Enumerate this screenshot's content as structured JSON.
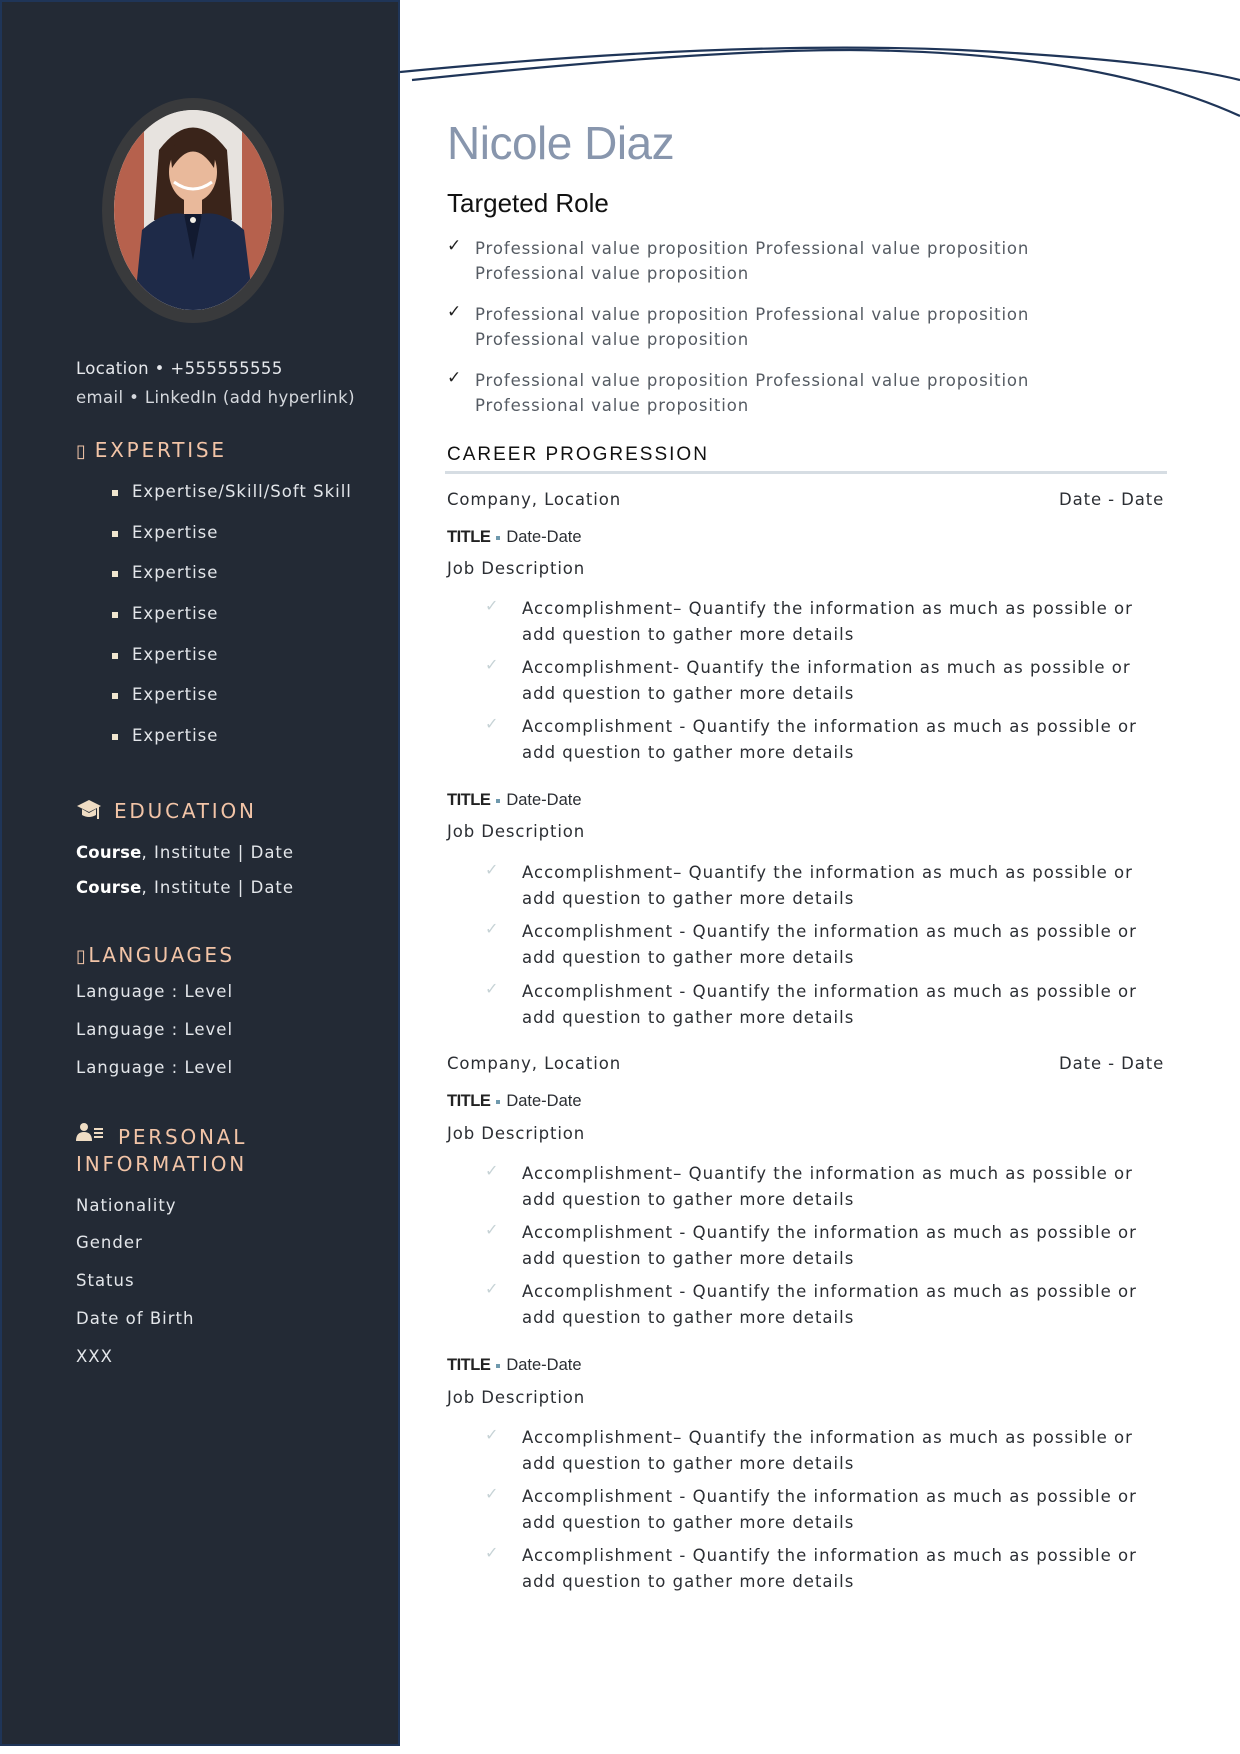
{
  "sidebar": {
    "photo_alt": "Profile photo of a smiling woman in a navy pinstripe blazer",
    "contact": {
      "line1": "Location • +555555555",
      "line2": "email • LinkedIn (add hyperlink)"
    },
    "expertise": {
      "icon": "▯",
      "title": "EXPERTISE",
      "items": [
        "Expertise/Skill/Soft Skill",
        "Expertise",
        "Expertise",
        "Expertise",
        "Expertise",
        "Expertise",
        "Expertise"
      ]
    },
    "education": {
      "title": "EDUCATION",
      "items": [
        {
          "course": "Course",
          "rest": ", Institute | Date"
        },
        {
          "course": "Course",
          "rest": ", Institute | Date"
        }
      ]
    },
    "languages": {
      "icon": "▯",
      "title": "LANGUAGES",
      "items": [
        "Language : Level",
        "Language : Level",
        "Language : Level"
      ]
    },
    "personal": {
      "title_line1": "PERSONAL",
      "title_line2": "INFORMATION",
      "items": [
        "Nationality",
        "Gender",
        "Status",
        "Date of Birth",
        "XXX"
      ]
    }
  },
  "header": {
    "name": "Nicole Diaz",
    "role": "Targeted Role",
    "value_props": [
      "Professional value proposition Professional value proposition Professional value proposition",
      "Professional value proposition Professional value proposition Professional value proposition",
      "Professional value proposition Professional value proposition Professional value proposition"
    ]
  },
  "career": {
    "title": "CAREER PROGRESSION",
    "companies": [
      {
        "company": "Company, Location",
        "dates": "Date - Date",
        "roles": [
          {
            "title": "TITLE",
            "dates": "Date-Date",
            "description": "Job Description",
            "accomplishments": [
              "Accomplishment– Quantify the information as much as possible or add question to gather more details",
              "Accomplishment- Quantify the information as much as possible or add question to gather more details",
              "Accomplishment - Quantify the information as much as possible or add question to gather more details"
            ]
          },
          {
            "title": "TITLE",
            "dates": "Date-Date",
            "description": "Job Description",
            "accomplishments": [
              "Accomplishment– Quantify the information as much as possible or add question to gather more details",
              "Accomplishment - Quantify the information as much as possible or add question to gather more details",
              "Accomplishment - Quantify the information as much as possible or add question to gather more details"
            ]
          }
        ]
      },
      {
        "company": "Company, Location",
        "dates": "Date - Date",
        "roles": [
          {
            "title": "TITLE",
            "dates": "Date-Date",
            "description": "Job Description",
            "accomplishments": [
              "Accomplishment– Quantify the information as much as possible or add question to gather more details",
              "Accomplishment - Quantify the information as much as possible or add question to gather more details",
              "Accomplishment - Quantify the information as much as possible or add question to gather more details"
            ]
          },
          {
            "title": "TITLE",
            "dates": "Date-Date",
            "description": "Job Description",
            "accomplishments": [
              "Accomplishment– Quantify the information as much as possible or add question to gather more details",
              "Accomplishment - Quantify the information as much as possible or add question to gather more details",
              "Accomplishment - Quantify the information as much as possible or add question to gather more details"
            ]
          }
        ]
      }
    ]
  },
  "colors": {
    "sidebar_bg": "#232a35",
    "sidebar_border": "#1f3558",
    "accent_heading": "#f2c4a7",
    "name_color": "#8896ad",
    "rule_color": "#d6dde3",
    "title_dot": "#6f99ad"
  }
}
